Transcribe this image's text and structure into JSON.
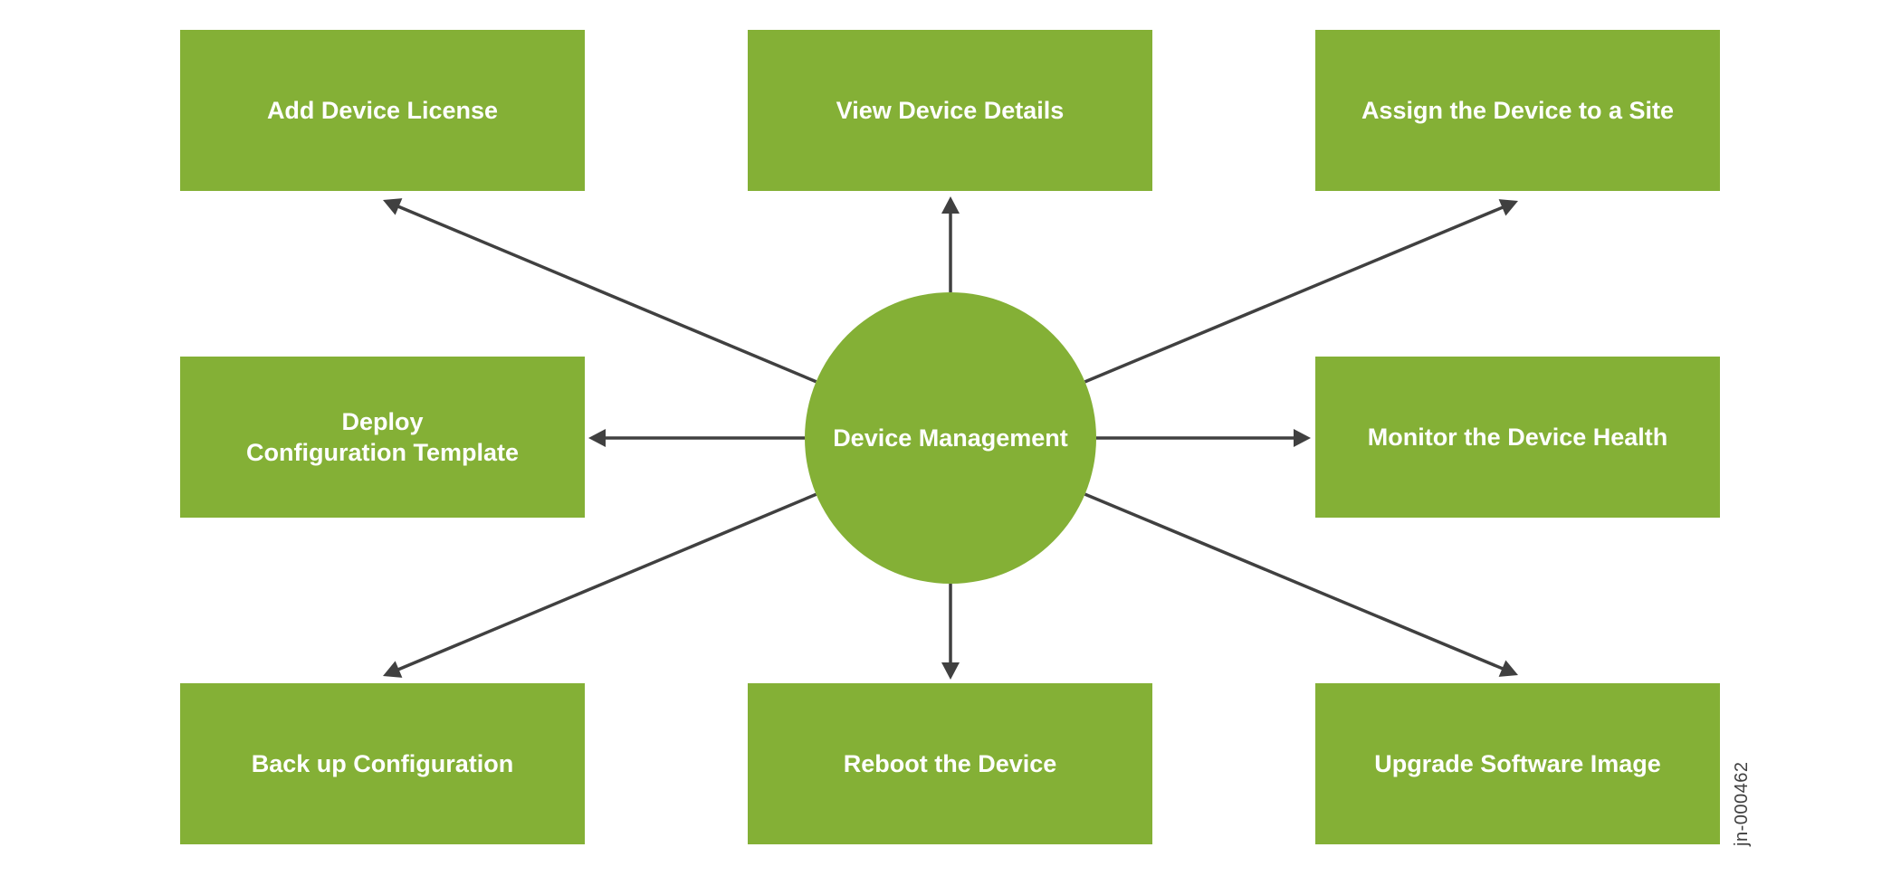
{
  "diagram": {
    "hub": {
      "label": "Device Management"
    },
    "nodes": [
      {
        "id": "add-device-license",
        "label": "Add Device License",
        "position": "top-left"
      },
      {
        "id": "view-device-details",
        "label": "View Device Details",
        "position": "top-center"
      },
      {
        "id": "assign-device-to-site",
        "label": "Assign the Device to a Site",
        "position": "top-right"
      },
      {
        "id": "deploy-configuration-template",
        "label": "Deploy\nConfiguration Template",
        "position": "middle-left"
      },
      {
        "id": "monitor-device-health",
        "label": "Monitor the Device Health",
        "position": "middle-right"
      },
      {
        "id": "back-up-configuration",
        "label": "Back up Configuration",
        "position": "bottom-left"
      },
      {
        "id": "reboot-device",
        "label": "Reboot the Device",
        "position": "bottom-center"
      },
      {
        "id": "upgrade-software-image",
        "label": "Upgrade Software Image",
        "position": "bottom-right"
      }
    ],
    "edges": [
      {
        "from": "hub",
        "to": "add-device-license"
      },
      {
        "from": "hub",
        "to": "view-device-details"
      },
      {
        "from": "hub",
        "to": "assign-device-to-site"
      },
      {
        "from": "hub",
        "to": "deploy-configuration-template"
      },
      {
        "from": "hub",
        "to": "monitor-device-health"
      },
      {
        "from": "hub",
        "to": "back-up-configuration"
      },
      {
        "from": "hub",
        "to": "reboot-device"
      },
      {
        "from": "hub",
        "to": "upgrade-software-image"
      }
    ],
    "figure_id": "jn-000462",
    "colors": {
      "node_fill": "#84B036",
      "node_text": "#FFFFFF",
      "arrow": "#404040"
    }
  }
}
